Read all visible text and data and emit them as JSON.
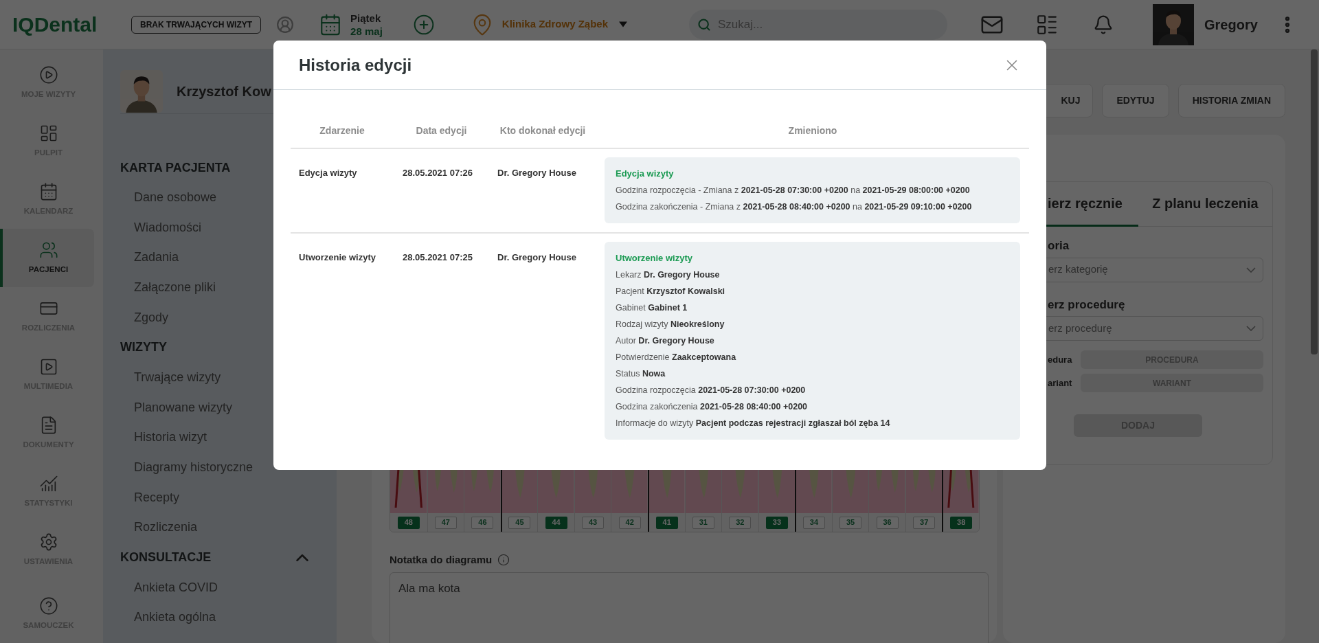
{
  "top_bar": {
    "logo": "IQDental",
    "visit_status": "BRAK TRWAJĄCYCH WIZYT",
    "day": "Piątek",
    "date": "28 maj",
    "clinic": "Klinika Zdrowy Ząbek",
    "search": {
      "placeholder": "Szukaj..."
    },
    "user": "Gregory"
  },
  "nav_rail": [
    {
      "label": "MOJE WIZYTY",
      "selected": false
    },
    {
      "label": "PULPIT",
      "selected": false
    },
    {
      "label": "KALENDARZ",
      "selected": false
    },
    {
      "label": "PACJENCI",
      "selected": true
    },
    {
      "label": "ROZLICZENIA",
      "selected": false
    },
    {
      "label": "MULTIMEDIA",
      "selected": false
    },
    {
      "label": "DOKUMENTY",
      "selected": false
    },
    {
      "label": "STATYSTYKI",
      "selected": false
    },
    {
      "label": "USTAWIENIA",
      "selected": false
    },
    {
      "label": "SAMOUCZEK",
      "selected": false
    }
  ],
  "patient": {
    "name": "Krzysztof Kow"
  },
  "patient_menu": [
    {
      "heading": "KARTA PACJENTA",
      "items": [
        "Dane osobowe",
        "Wiadomości",
        "Zadania",
        "Załączone pliki",
        "Zgody"
      ]
    },
    {
      "heading": "WIZYTY",
      "items": [
        "Trwające wizyty",
        "Planowane wizyty",
        "Historia wizyt",
        "Diagramy historyczne",
        "Recepty",
        "Rozliczenia"
      ]
    },
    {
      "heading": "KONSULTACJE",
      "expanded": true,
      "items": [
        "Ankieta COVID",
        "Ankieta ogólna"
      ]
    }
  ],
  "actions": [
    "KUJ",
    "EDYTUJ",
    "HISTORIA ZMIAN"
  ],
  "procedure_panel": {
    "tabs": [
      {
        "label": "ierz ręcznie",
        "selected": true
      },
      {
        "label": "Z planu leczenia",
        "selected": false
      }
    ],
    "category_label": "oria",
    "category": {
      "placeholder": "erz kategorię"
    },
    "procedure_label": "erz procedurę",
    "procedure": {
      "placeholder": "erz procedurę"
    },
    "fields": [
      {
        "label": "edura",
        "value": "PROCEDURA"
      },
      {
        "label": "ariant",
        "value": "WARIANT"
      }
    ],
    "add_button": {
      "label": "DODAJ",
      "disabled": true
    }
  },
  "tooth_chart": {
    "teeth": [
      {
        "number": "48",
        "selected": true,
        "missing": true
      },
      {
        "number": "47",
        "selected": false,
        "missing": false
      },
      {
        "number": "46",
        "selected": false,
        "missing": false
      },
      {
        "number": "45",
        "selected": false,
        "missing": false
      },
      {
        "number": "44",
        "selected": true,
        "missing": false
      },
      {
        "number": "43",
        "selected": false,
        "missing": false
      },
      {
        "number": "42",
        "selected": false,
        "missing": false
      },
      {
        "number": "41",
        "selected": true,
        "missing": false
      },
      {
        "number": "31",
        "selected": false,
        "missing": false
      },
      {
        "number": "32",
        "selected": false,
        "missing": false
      },
      {
        "number": "33",
        "selected": true,
        "missing": false
      },
      {
        "number": "34",
        "selected": false,
        "missing": false
      },
      {
        "number": "35",
        "selected": false,
        "missing": false
      },
      {
        "number": "36",
        "selected": false,
        "missing": false
      },
      {
        "number": "37",
        "selected": false,
        "missing": false
      },
      {
        "number": "38",
        "selected": true,
        "missing": true
      }
    ]
  },
  "diagram_note": {
    "label": "Notatka do diagramu",
    "value": "Ala ma kota"
  },
  "modal": {
    "title": "Historia edycji",
    "columns": [
      "Zdarzenie",
      "Data edycji",
      "Kto dokonał edycji",
      "Zmieniono"
    ],
    "rows": [
      {
        "event": "Edycja wizyty",
        "date": "28.05.2021 07:26",
        "author": "Dr. Gregory House",
        "changes": {
          "title": "Edycja wizyty",
          "lines": [
            "Godzina rozpoczęcia - Zmiana z **2021-05-28 07:30:00 +0200** na **2021-05-29 08:00:00 +0200**",
            "Godzina zakończenia - Zmiana z **2021-05-28 08:40:00 +0200** na **2021-05-29 09:10:00 +0200**"
          ]
        }
      },
      {
        "event": "Utworzenie wizyty",
        "date": "28.05.2021 07:25",
        "author": "Dr. Gregory House",
        "changes": {
          "title": "Utworzenie wizyty",
          "lines": [
            "Lekarz **Dr. Gregory House**",
            "Pacjent **Krzysztof Kowalski**",
            "Gabinet **Gabinet 1**",
            "Rodzaj wizyty **Nieokreślony**",
            "Autor **Dr. Gregory House**",
            "Potwierdzenie **Zaakceptowana**",
            "Status **Nowa**",
            "Godzina rozpoczęcia **2021-05-28 07:30:00 +0200**",
            "Godzina zakończenia **2021-05-28 08:40:00 +0200**",
            "Informacje do wizyty **Pacjent podczas rejestracji zgłaszał ból zęba 14**"
          ]
        }
      }
    ]
  }
}
